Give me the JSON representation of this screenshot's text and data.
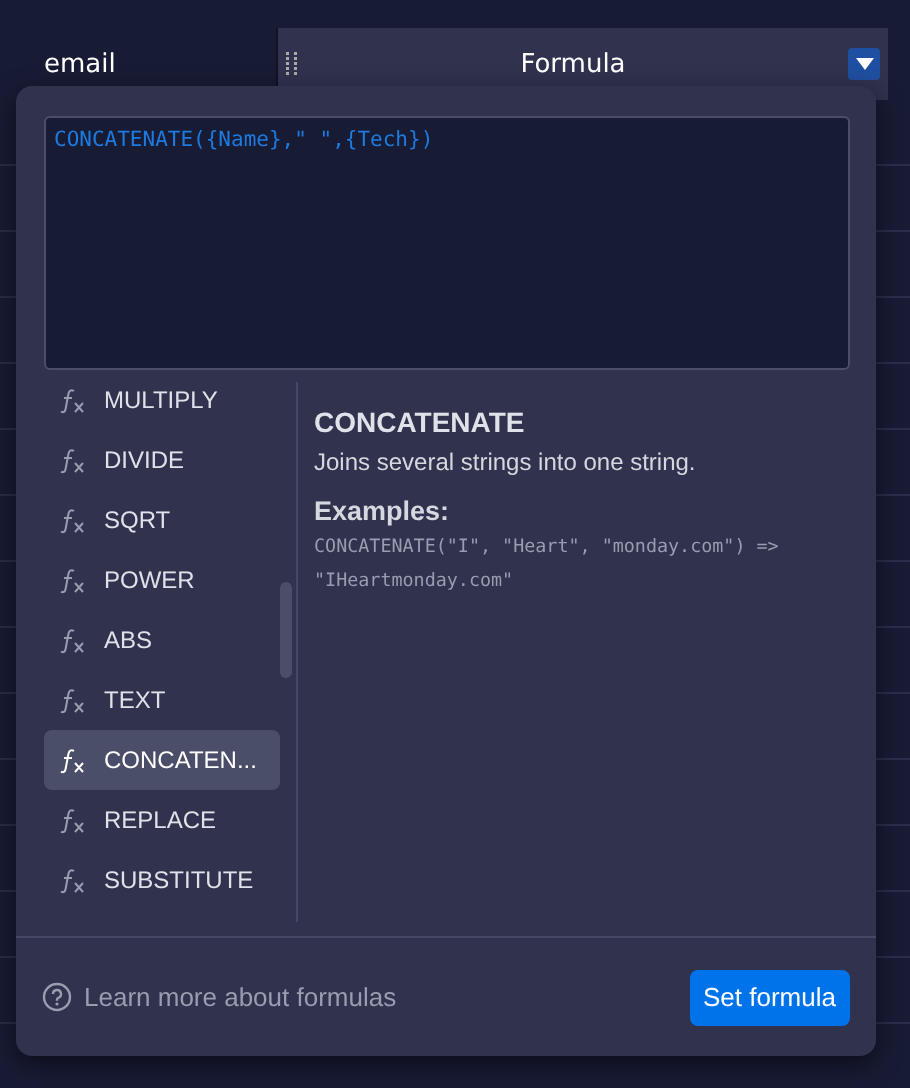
{
  "header": {
    "columns": [
      {
        "title": "email"
      },
      {
        "title": "Formula"
      }
    ]
  },
  "formula_editor": {
    "value": "CONCATENATE({Name},\" \",{Tech})"
  },
  "functions": [
    {
      "name": "MULTIPLY",
      "selected": false
    },
    {
      "name": "DIVIDE",
      "selected": false
    },
    {
      "name": "SQRT",
      "selected": false
    },
    {
      "name": "POWER",
      "selected": false
    },
    {
      "name": "ABS",
      "selected": false
    },
    {
      "name": "TEXT",
      "selected": false
    },
    {
      "name": "CONCATEN...",
      "selected": true
    },
    {
      "name": "REPLACE",
      "selected": false
    },
    {
      "name": "SUBSTITUTE",
      "selected": false
    }
  ],
  "details": {
    "title": "CONCATENATE",
    "description": "Joins several strings into one string.",
    "examples_label": "Examples:",
    "example": "CONCATENATE(\"I\", \"Heart\", \"monday.com\") => \"IHeartmonday.com\""
  },
  "footer": {
    "help_link": "Learn more about formulas",
    "button": "Set formula"
  }
}
